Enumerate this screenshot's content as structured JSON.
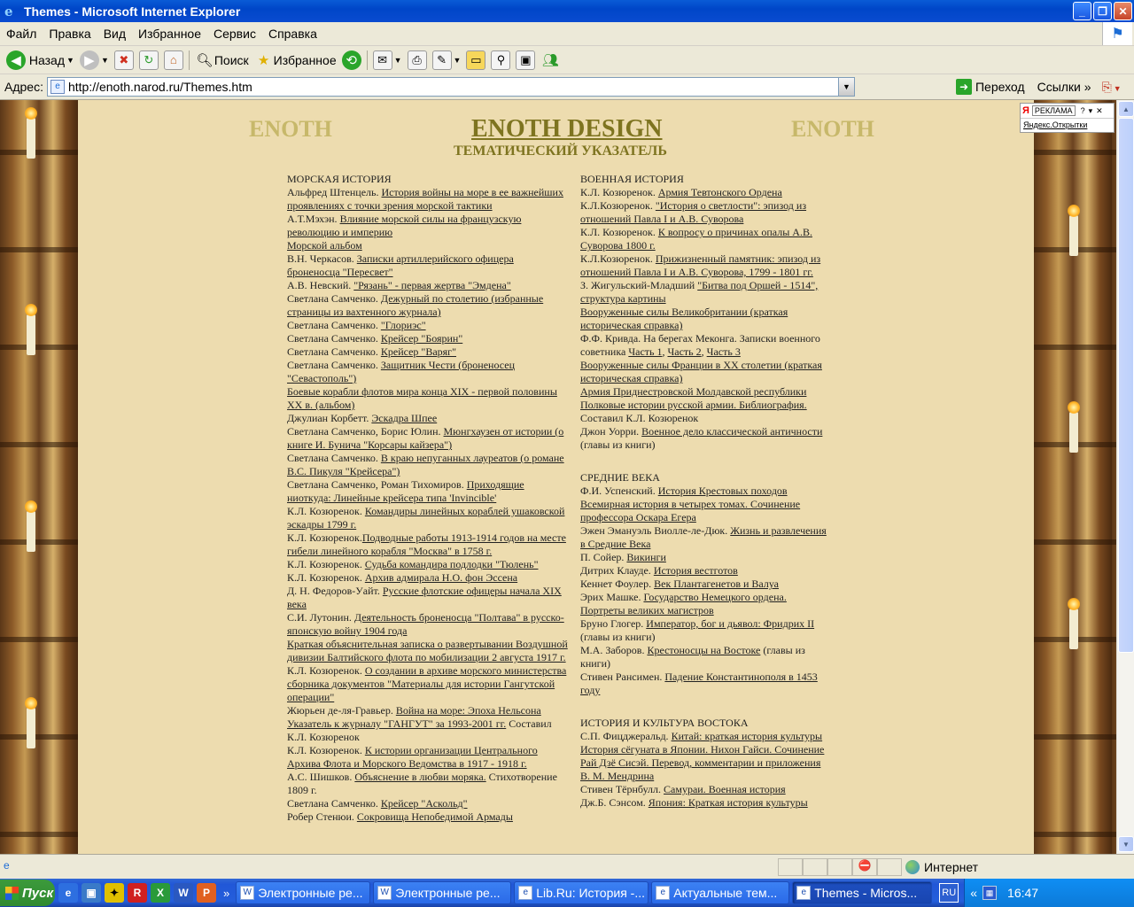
{
  "window": {
    "title": "Themes - Microsoft Internet Explorer"
  },
  "menu": [
    "Файл",
    "Правка",
    "Вид",
    "Избранное",
    "Сервис",
    "Справка"
  ],
  "toolbar": {
    "back": "Назад",
    "search": "Поиск",
    "favorites": "Избранное"
  },
  "address": {
    "label": "Адрес:",
    "url": "http://enoth.narod.ru/Themes.htm",
    "go": "Переход",
    "links": "Ссылки"
  },
  "ad": {
    "label": "РЕКЛАМА",
    "link": "Яндекс.Открытки"
  },
  "page": {
    "left": "ENOTH",
    "right": "ENOTH",
    "title": "ENOTH DESIGN",
    "subtitle": "ТЕМАТИЧЕСКИЙ УКАЗАТЕЛЬ"
  },
  "col1": {
    "head": "МОРСКАЯ ИСТОРИЯ",
    "items": [
      {
        "pre": "Альфред Штенцель. ",
        "link": "История войны на море в ее важнейших проявлениях с точки зрения морской тактики",
        "post": ""
      },
      {
        "pre": "А.Т.Мэхэн. ",
        "link": "Влияние морской силы на французскую революцию и империю",
        "post": ""
      },
      {
        "pre": "",
        "link": "Морской альбом",
        "post": ""
      },
      {
        "pre": "В.Н. Черкасов. ",
        "link": "Записки артиллерийского офицера броненосца \"Пересвет\"",
        "post": ""
      },
      {
        "pre": "А.В. Невский. ",
        "link": "\"Рязань\" - первая жертва \"Эмдена\"",
        "post": ""
      },
      {
        "pre": "Светлана Самченко. ",
        "link": "Дежурный по столетию (избранные страницы из вахтенного журнала)",
        "post": ""
      },
      {
        "pre": "Светлана Самченко. ",
        "link": "\"Глориэс\"",
        "post": ""
      },
      {
        "pre": "Светлана Самченко. ",
        "link": "Крейсер \"Боярин\"",
        "post": ""
      },
      {
        "pre": "Светлана Самченко. ",
        "link": "Крейсер \"Варяг\"",
        "post": ""
      },
      {
        "pre": "Светлана Самченко. ",
        "link": "Защитник Чести (броненосец \"Севастополь\")",
        "post": ""
      },
      {
        "pre": "",
        "link": "Боевые корабли флотов мира конца XIX - первой половины XX в. (альбом)",
        "post": ""
      },
      {
        "pre": "Джулиан Корбетт. ",
        "link": "Эскадра Шпее",
        "post": ""
      },
      {
        "pre": "Светлана Самченко, Борис Юлин. ",
        "link": "Мюнгхаузен от истории (о книге И. Бунича \"Корсары кайзера\")",
        "post": ""
      },
      {
        "pre": "Светлана Самченко. ",
        "link": "В краю непуганных лауреатов (о романе В.С. Пикуля \"Крейсера\")",
        "post": ""
      },
      {
        "pre": "Светлана Самченко, Роман Тихомиров. ",
        "link": "Приходящие ниоткуда: Линейные крейсера типа 'Invincible'",
        "post": ""
      },
      {
        "pre": "К.Л. Козюренок. ",
        "link": "Командиры линейных кораблей ушаковской эскадры 1799 г.",
        "post": ""
      },
      {
        "pre": "К.Л. Козюренок.",
        "link": "Подводные работы 1913-1914 годов на месте гибели линейного корабля \"Москва\" в 1758 г.",
        "post": ""
      },
      {
        "pre": "К.Л. Козюренок. ",
        "link": "Судьба командира подлодки \"Тюлень\"",
        "post": ""
      },
      {
        "pre": "К.Л. Козюренок. ",
        "link": "Архив адмирала Н.О. фон Эссена",
        "post": ""
      },
      {
        "pre": "Д. Н. Федоров-Уайт. ",
        "link": "Русские флотские офицеры начала XIX века",
        "post": ""
      },
      {
        "pre": "С.И. Лутонин. ",
        "link": "Деятельность броненосца \"Полтава\" в русско-японскую войну 1904 года",
        "post": ""
      },
      {
        "pre": "",
        "link": "Краткая объяснительная записка о развертывании Воздушной дивизии Балтийского флота по мобилизации 2 августа 1917 г.",
        "post": ""
      },
      {
        "pre": "К.Л. Козюренок. ",
        "link": "О создании в архиве морского министерства сборника документов \"Материалы для истории Гангутской операции\"",
        "post": ""
      },
      {
        "pre": "Жюрьен де-ля-Гравьер. ",
        "link": "Война на море: Эпоха Нельсона",
        "post": ""
      },
      {
        "pre": " ",
        "link": "Указатель к журналу \"ГАНГУТ\" за 1993-2001 гг.",
        "post": " Составил К.Л. Козюренок"
      },
      {
        "pre": "К.Л. Козюренок. ",
        "link": "К истории организации Центрального Архива Флота и Морского Ведомства в 1917 - 1918 г.",
        "post": ""
      },
      {
        "pre": "А.С. Шишков. ",
        "link": "Объяснение в любви моряка.",
        "post": " Стихотворение 1809 г."
      },
      {
        "pre": "Светлана Самченко. ",
        "link": "Крейсер \"Аскольд\"",
        "post": ""
      },
      {
        "pre": "Робер Стенюи. ",
        "link": "Сокровища Непобедимой Армады",
        "post": ""
      }
    ]
  },
  "col2": {
    "sections": [
      {
        "head": "ВОЕННАЯ ИСТОРИЯ",
        "items": [
          {
            "pre": "К.Л. Козюренок. ",
            "link": "Армия Тевтонского Ордена",
            "post": ""
          },
          {
            "pre": "К.Л.Козюренок. ",
            "link": "\"История о светлости\": эпизод из отношений Павла I и А.В. Суворова",
            "post": ""
          },
          {
            "pre": "К.Л. Козюренок. ",
            "link": "К вопросу о причинах опалы А.В. Суворова 1800 г.",
            "post": ""
          },
          {
            "pre": "К.Л.Козюренок. ",
            "link": "Прижизненный памятник: эпизод из отношений Павла I и А.В. Суворова, 1799 - 1801 гг.",
            "post": ""
          },
          {
            "pre": "З. Жигульский-Младший ",
            "link": "\"Битва под Оршей - 1514\", структура картины",
            "post": ""
          },
          {
            "pre": "",
            "link": "Вооруженные силы Великобритании (краткая историческая справка)",
            "post": ""
          },
          {
            "pre": "Ф.Ф. Кривда. На берегах Меконга. Записки военного советника ",
            "link": "Часть 1",
            "post": ", ",
            "link2": "Часть 2",
            "post2": ", ",
            "link3": "Часть 3"
          },
          {
            "pre": "",
            "link": "Вооруженные силы Франции в XX столетии (краткая историческая справка)",
            "post": ""
          },
          {
            "pre": "",
            "link": "Армия Приднестровской Молдавской республики",
            "post": ""
          },
          {
            "pre": "",
            "link": "Полковые истории русской армии. Библиография.",
            "post": " Составил К.Л. Козюренок"
          },
          {
            "pre": "Джон Уорри. ",
            "link": "Военное дело классической античности",
            "post": " (главы из книги)"
          }
        ]
      },
      {
        "head": "СРЕДНИЕ ВЕКА",
        "items": [
          {
            "pre": "Ф.И. Успенский. ",
            "link": "История Крестовых походов",
            "post": ""
          },
          {
            "pre": "",
            "link": "Всемирная история в четырех томах. Сочинение профессора Оскара Егера",
            "post": ""
          },
          {
            "pre": "Эжен Эмануэль Виолле-ле-Дюк. ",
            "link": "Жизнь и развлечения в Средние Века",
            "post": ""
          },
          {
            "pre": "П. Сойер. ",
            "link": "Викинги",
            "post": ""
          },
          {
            "pre": "Дитрих Клауде. ",
            "link": "История вестготов",
            "post": ""
          },
          {
            "pre": "Кеннет Фоулер. ",
            "link": "Век Плантагенетов и Валуа",
            "post": ""
          },
          {
            "pre": "Эрих Машке. ",
            "link": "Государство Немецкого ордена. Портреты великих магистров",
            "post": ""
          },
          {
            "pre": "Бруно Глогер. ",
            "link": "Император, бог и дьявол: Фридрих II",
            "post": " (главы из книги)"
          },
          {
            "pre": "М.А. Заборов. ",
            "link": "Крестоносцы на Востоке",
            "post": " (главы из книги)"
          },
          {
            "pre": "Стивен Рансимен. ",
            "link": "Падение Константинополя в 1453 году",
            "post": ""
          }
        ]
      },
      {
        "head": "ИСТОРИЯ И КУЛЬТУРА ВОСТОКА",
        "items": [
          {
            "pre": "С.П. Фицджеральд. ",
            "link": "Китай: краткая история культуры",
            "post": ""
          },
          {
            "pre": "",
            "link": "История сёгуната в Японии. Нихон Гайси. Сочинение Рай Дзё Сисэй. Перевод, комментарии и приложения В. М. Мендрина",
            "post": ""
          },
          {
            "pre": "Стивен Тёрнбулл. ",
            "link": "Самураи. Военная история",
            "post": ""
          },
          {
            "pre": "Дж.Б. Сэнсом. ",
            "link": "Япония: Краткая история культуры",
            "post": ""
          }
        ]
      }
    ]
  },
  "status": {
    "zone": "Интернет"
  },
  "taskbar": {
    "start": "Пуск",
    "tasks": [
      "Электронные ре...",
      "Электронные ре...",
      "Lib.Ru: История -...",
      "Актуальные тем...",
      "Themes - Micros..."
    ],
    "lang": "RU",
    "clock": "16:47"
  }
}
